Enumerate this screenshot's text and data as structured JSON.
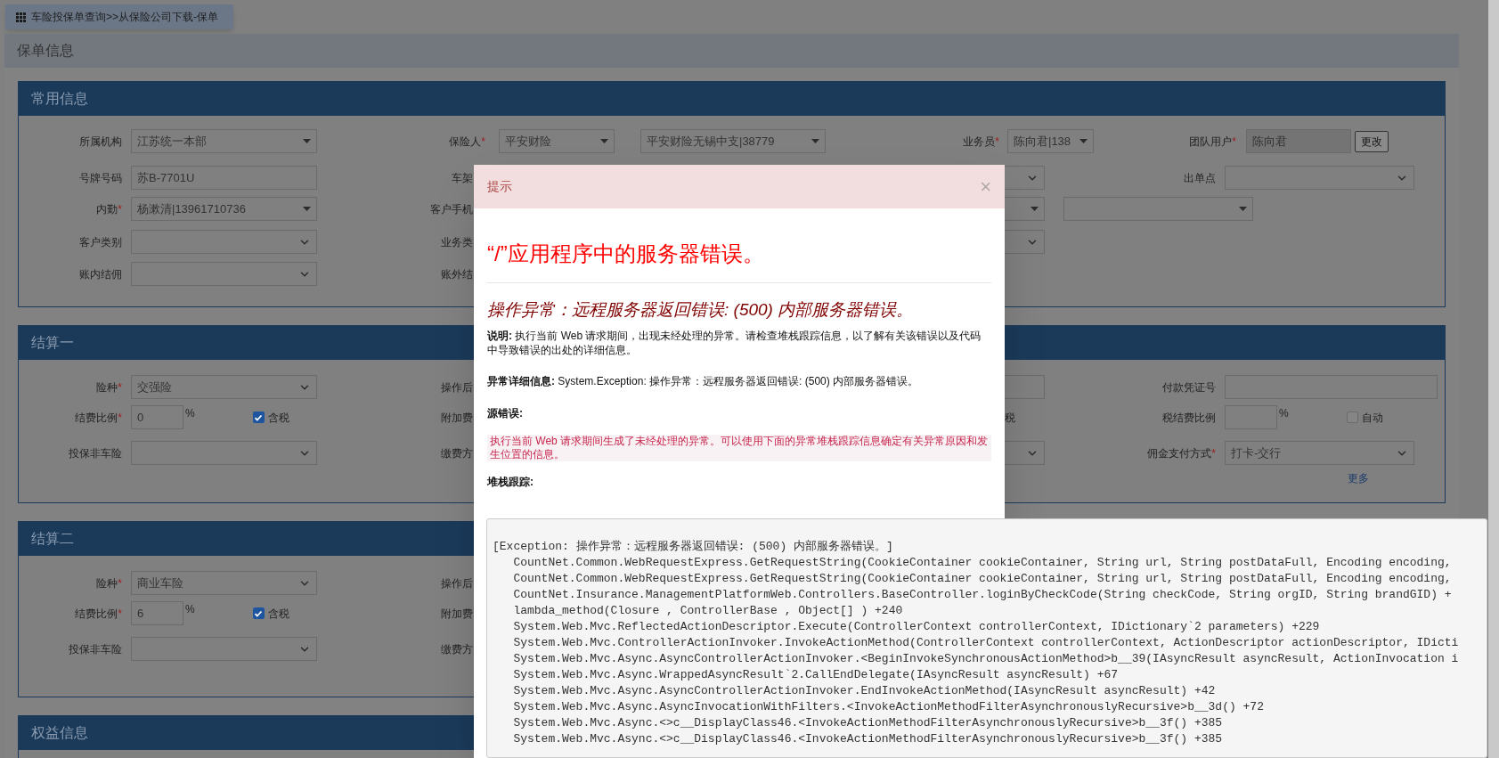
{
  "breadcrumb": "车险投保单查询>>从保险公司下载-保单",
  "page_title": "保单信息",
  "common_info": {
    "title": "常用信息",
    "first_row": {
      "org": {
        "label": "所属机构",
        "kind": "dropdown",
        "value": "江苏统一本部"
      },
      "insurer": {
        "label": "保险人",
        "required_mark": "*",
        "kind": "dropdown",
        "value": "平安财险"
      },
      "branch": {
        "kind": "dropdown",
        "value": "平安财险无锡中支|38779"
      },
      "salesman": {
        "label": "业务员",
        "required_mark": "*",
        "kind": "dropdown",
        "value": "陈向君|138"
      },
      "team_user": {
        "label": "团队用户",
        "required_mark": "*",
        "kind": "text",
        "disabled": true,
        "value": "陈向君"
      },
      "change_button": "更改"
    },
    "rows": [
      {
        "left": {
          "label": "号牌号码",
          "kind": "text",
          "value": "苏B-7701U"
        },
        "middle_label": "车架",
        "stub": {
          "kind": "select"
        },
        "right": {
          "label": "出单点",
          "kind": "select"
        }
      },
      {
        "left": {
          "label": "内勤",
          "required_mark": "*",
          "kind": "dropdown",
          "value": "杨漱清|13961710736"
        },
        "middle_label": "客户手机",
        "stub": {
          "kind": "dropdown"
        },
        "extra": {
          "kind": "dropdown"
        }
      },
      {
        "left": {
          "label": "客户类别",
          "kind": "select"
        },
        "middle_label": "业务类",
        "stub": {
          "kind": "select"
        }
      },
      {
        "left": {
          "label": "账内结佣",
          "kind": "select"
        },
        "middle_label": "账外结"
      }
    ]
  },
  "settlements": [
    {
      "title": "结算一",
      "rows": [
        {
          "left": {
            "label": "险种",
            "required_mark": "*",
            "kind": "select",
            "value": "交强险"
          },
          "middle_label": "操作后",
          "stub": {
            "kind": "text"
          },
          "right": {
            "label": "付款凭证号",
            "kind": "text"
          }
        },
        {
          "left": {
            "label": "结费比例",
            "required_mark": "*",
            "kind": "percent",
            "value": "0",
            "unit": "%",
            "checkbox": {
              "label": "含税",
              "checked": true
            }
          },
          "middle_label": "附加费",
          "stub_text": "税",
          "right": {
            "label": "税结费比例",
            "kind": "percent",
            "unit": "%",
            "checkbox": {
              "label": "自动",
              "checked": false
            }
          }
        },
        {
          "left": {
            "label": "投保非车险",
            "kind": "select"
          },
          "middle_label": "缴费方",
          "stub": {
            "kind": "select"
          },
          "right": {
            "label": "佣金支付方式",
            "required_mark": "*",
            "kind": "select",
            "value": "打卡-交行"
          }
        }
      ],
      "more_link": "更多"
    },
    {
      "title": "结算二",
      "rows": [
        {
          "left": {
            "label": "险种",
            "required_mark": "*",
            "kind": "select",
            "value": "商业车险"
          },
          "middle_label": "操作后"
        },
        {
          "left": {
            "label": "结费比例",
            "required_mark": "*",
            "kind": "percent",
            "value": "6",
            "unit": "%",
            "checkbox": {
              "label": "含税",
              "checked": true
            }
          },
          "middle_label": "附加费"
        },
        {
          "left": {
            "label": "投保非车险",
            "kind": "select"
          },
          "middle_label": "缴费方"
        }
      ]
    }
  ],
  "benefits": {
    "title": "权益信息"
  },
  "modal": {
    "title": "提示",
    "close": "×",
    "heading": "“/”应用程序中的服务器错误。",
    "subheading": "操作异常：远程服务器返回错误: (500) 内部服务器错误。",
    "description": "**说明:** 执行当前 Web 请求期间，出现未经处理的异常。请检查堆栈跟踪信息，以了解有关该错误以及代码中导致错误的出处的详细信息。",
    "exception_details": "**异常详细信息:** System.Exception: 操作异常：远程服务器返回错误: (500) 内部服务器错误。",
    "source_error_label": "源错误:",
    "source_error": "执行当前 Web 请求期间生成了未经处理的异常。可以使用下面的异常堆栈跟踪信息确定有关异常原因和发生位置的信息。",
    "stack_trace_label": "堆栈跟踪:"
  },
  "stack_trace": [
    "[Exception: 操作异常：远程服务器返回错误: (500) 内部服务器错误。]",
    "   CountNet.Common.WebRequestExpress.GetRequestString(CookieContainer cookieContainer, String url, String postDataFull, Encoding encoding,",
    "   CountNet.Common.WebRequestExpress.GetRequestString(CookieContainer cookieContainer, String url, String postDataFull, Encoding encoding,",
    "   CountNet.Insurance.ManagementPlatformWeb.Controllers.BaseController.loginByCheckCode(String checkCode, String orgID, String brandGID) +",
    "   lambda_method(Closure , ControllerBase , Object[] ) +240",
    "   System.Web.Mvc.ReflectedActionDescriptor.Execute(ControllerContext controllerContext, IDictionary`2 parameters) +229",
    "   System.Web.Mvc.ControllerActionInvoker.InvokeActionMethod(ControllerContext controllerContext, ActionDescriptor actionDescriptor, IDicti",
    "   System.Web.Mvc.Async.AsyncControllerActionInvoker.<BeginInvokeSynchronousActionMethod>b__39(IAsyncResult asyncResult, ActionInvocation i",
    "   System.Web.Mvc.Async.WrappedAsyncResult`2.CallEndDelegate(IAsyncResult asyncResult) +67",
    "   System.Web.Mvc.Async.AsyncControllerActionInvoker.EndInvokeActionMethod(IAsyncResult asyncResult) +42",
    "   System.Web.Mvc.Async.AsyncInvocationWithFilters.<InvokeActionMethodFilterAsynchronouslyRecursive>b__3d() +72",
    "   System.Web.Mvc.Async.<>c__DisplayClass46.<InvokeActionMethodFilterAsynchronouslyRecursive>b__3f() +385",
    "   System.Web.Mvc.Async.<>c__DisplayClass46.<InvokeActionMethodFilterAsynchronouslyRecursive>b__3f() +385"
  ]
}
